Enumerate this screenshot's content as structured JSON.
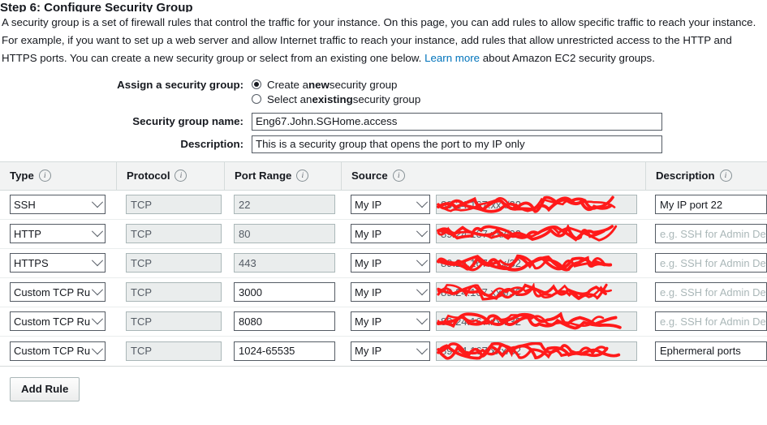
{
  "page": {
    "title_fragment": "Step 6: Configure Security Group",
    "intro_before_link": "A security group is a set of firewall rules that control the traffic for your instance. On this page, you can add rules to allow specific traffic to reach your instance. For example, if you want to set up a web server and allow Internet traffic to reach your instance, add rules that allow unrestricted access to the HTTP and HTTPS ports. You can create a new security group or select from an existing one below. ",
    "learn_more": "Learn more",
    "intro_after_link": " about Amazon EC2 security groups.",
    "link_color": "#0073bb"
  },
  "form": {
    "assign_label": "Assign a security group:",
    "option_new": {
      "prefix": "Create a ",
      "bold": "new",
      "suffix": " security group",
      "selected": true
    },
    "option_existing": {
      "prefix": "Select an ",
      "bold": "existing",
      "suffix": " security group",
      "selected": false
    },
    "name_label": "Security group name:",
    "name_value": "Eng67.John.SGHome.access",
    "description_label": "Description:",
    "description_value": "This is a security group that opens the port to my IP only"
  },
  "table": {
    "headers": [
      {
        "label": "Type",
        "info": "info-icon"
      },
      {
        "label": "Protocol",
        "info": "info-icon"
      },
      {
        "label": "Port Range",
        "info": "info-icon"
      },
      {
        "label": "Source",
        "info": "info-icon"
      },
      {
        "label": "Description",
        "info": "info-icon"
      }
    ],
    "description_placeholder": "e.g. SSH for Admin Desktop",
    "rows": [
      {
        "type": "SSH",
        "protocol": "TCP",
        "port": "22",
        "port_editable": false,
        "source_select": "My IP",
        "source_value": "89.24.167.xxx/32",
        "source_redacted": true,
        "description": "My IP port 22",
        "description_is_placeholder": false
      },
      {
        "type": "HTTP",
        "protocol": "TCP",
        "port": "80",
        "port_editable": false,
        "source_select": "My IP",
        "source_value": "89.24.167.xxx/32",
        "source_redacted": true,
        "description": "e.g. SSH for Admin Desktop",
        "description_is_placeholder": true
      },
      {
        "type": "HTTPS",
        "protocol": "TCP",
        "port": "443",
        "port_editable": false,
        "source_select": "My IP",
        "source_value": "89.24.167.xxx/32",
        "source_redacted": true,
        "description": "e.g. SSH for Admin Desktop",
        "description_is_placeholder": true
      },
      {
        "type": "Custom TCP Rule",
        "protocol": "TCP",
        "port": "3000",
        "port_editable": true,
        "source_select": "My IP",
        "source_value": "89.24.167.xxx/32",
        "source_redacted": true,
        "description": "e.g. SSH for Admin Desktop",
        "description_is_placeholder": true
      },
      {
        "type": "Custom TCP Rule",
        "protocol": "TCP",
        "port": "8080",
        "port_editable": true,
        "source_select": "My IP",
        "source_value": "89.24.167.xxx/32",
        "source_redacted": true,
        "description": "e.g. SSH for Admin Desktop",
        "description_is_placeholder": true
      },
      {
        "type": "Custom TCP Rule",
        "protocol": "TCP",
        "port": "1024-65535",
        "port_editable": true,
        "source_select": "My IP",
        "source_value": "89.24.167.xxx/32",
        "source_redacted": true,
        "description": "Ephermeral ports",
        "description_is_placeholder": false
      }
    ]
  },
  "actions": {
    "add_rule_label": "Add Rule"
  },
  "annotation": {
    "color": "#ff1a1a",
    "kind": "redaction-scribble"
  }
}
